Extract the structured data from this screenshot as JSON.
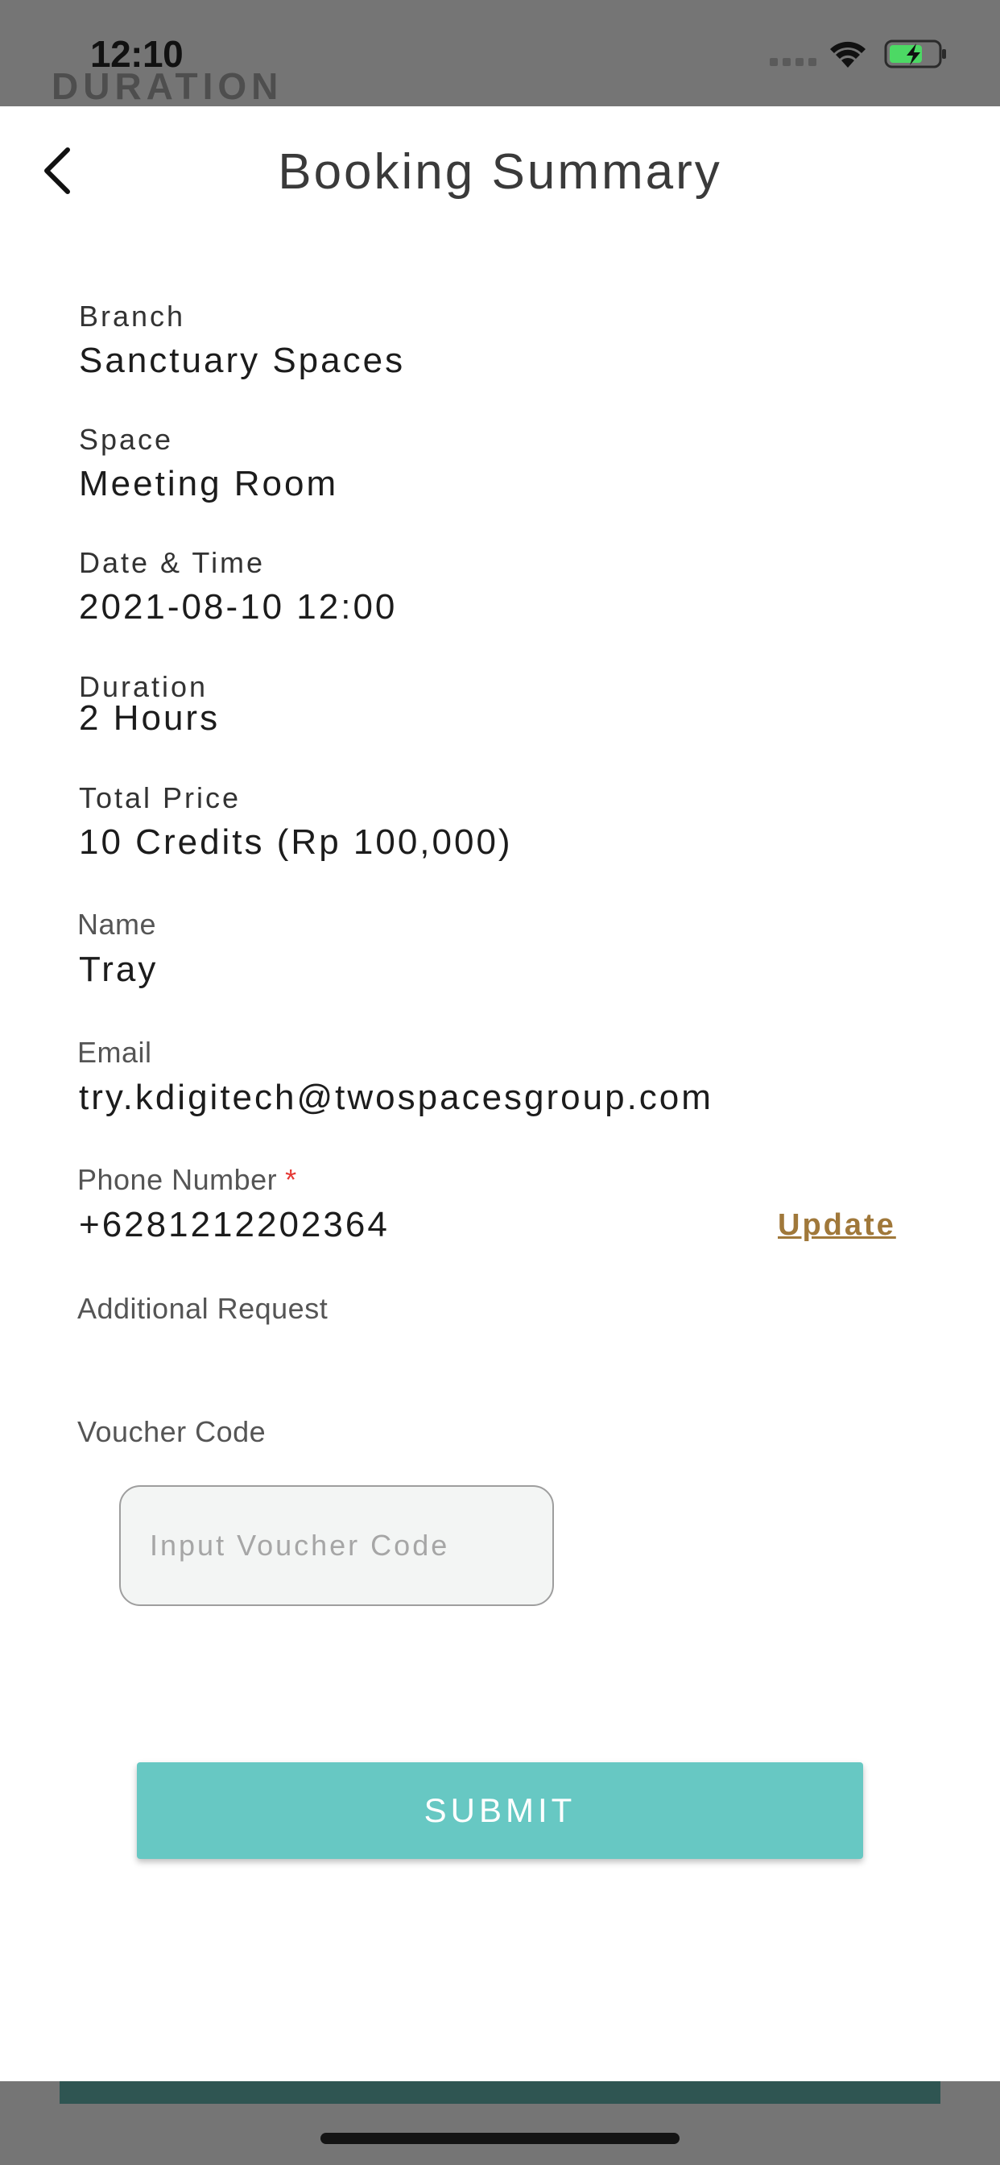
{
  "status_bar": {
    "time": "12:10",
    "behind_text": "DURATION",
    "battery_color": "#4cd964"
  },
  "header": {
    "title": "Booking Summary",
    "back_icon": "chevron-left-icon"
  },
  "summary": {
    "branch": {
      "label": "Branch",
      "value": "Sanctuary Spaces"
    },
    "space": {
      "label": "Space",
      "value": "Meeting Room"
    },
    "datetime": {
      "label": "Date & Time",
      "value": "2021-08-10 12:00"
    },
    "duration": {
      "label": "Duration",
      "value": "2 Hours"
    },
    "total_price": {
      "label": "Total Price",
      "value": "10 Credits (Rp 100,000)"
    },
    "name": {
      "label": "Name",
      "value": "Tray"
    },
    "email": {
      "label": "Email",
      "value": "try.kdigitech@twospacesgroup.com"
    },
    "phone": {
      "label": "Phone Number",
      "required_mark": "*",
      "value": "+6281212202364",
      "update_label": "Update"
    },
    "additional_request": {
      "label": "Additional Request"
    },
    "voucher": {
      "label": "Voucher Code",
      "placeholder": "Input Voucher Code",
      "value": ""
    }
  },
  "actions": {
    "submit_label": "SUBMIT"
  },
  "colors": {
    "accent": "#67c8c3",
    "link": "#a0783a",
    "required": "#e53935",
    "backdrop": "#757575"
  }
}
